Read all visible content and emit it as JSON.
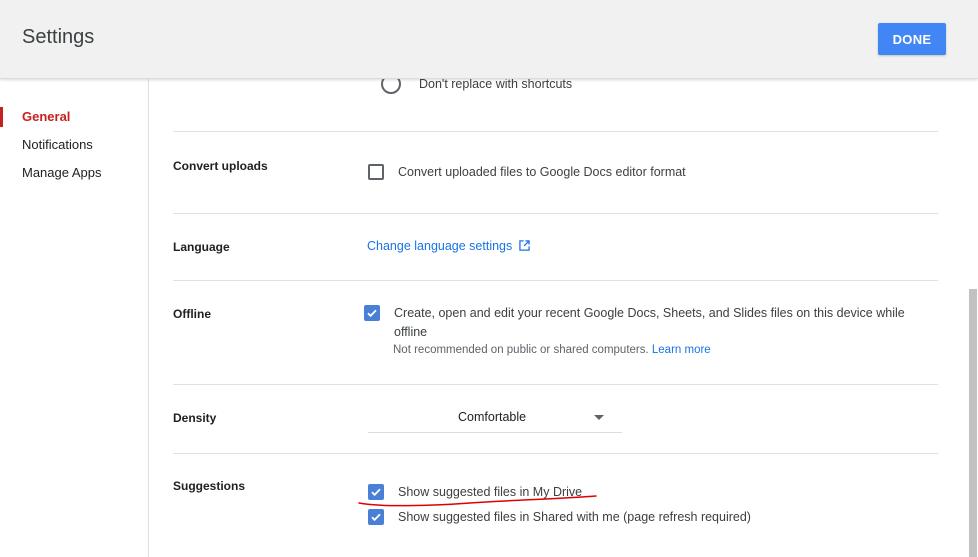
{
  "header": {
    "title": "Settings",
    "done_label": "DONE"
  },
  "sidebar": {
    "items": [
      {
        "label": "General",
        "active": true
      },
      {
        "label": "Notifications",
        "active": false
      },
      {
        "label": "Manage Apps",
        "active": false
      }
    ]
  },
  "settings": {
    "shortcuts": {
      "option_label": "Don't replace with shortcuts",
      "selected": false
    },
    "convert_uploads": {
      "label": "Convert uploads",
      "checkbox_label": "Convert uploaded files to Google Docs editor format",
      "checked": false
    },
    "language": {
      "label": "Language",
      "link_label": "Change language settings"
    },
    "offline": {
      "label": "Offline",
      "checkbox_label_line1": "Create, open and edit your recent Google Docs, Sheets, and Slides files on this device while",
      "checkbox_label_line2": "offline",
      "note": "Not recommended on public or shared computers.",
      "learn_more": "Learn more",
      "checked": true
    },
    "density": {
      "label": "Density",
      "selected": "Comfortable"
    },
    "suggestions": {
      "label": "Suggestions",
      "options": [
        {
          "label": "Show suggested files in My Drive",
          "checked": true
        },
        {
          "label": "Show suggested files in Shared with me (page refresh required)",
          "checked": true
        }
      ]
    }
  },
  "colors": {
    "accent": "#4285f4",
    "active_nav": "#c5221f",
    "link": "#1a73e8",
    "annotation": "#e00000"
  }
}
